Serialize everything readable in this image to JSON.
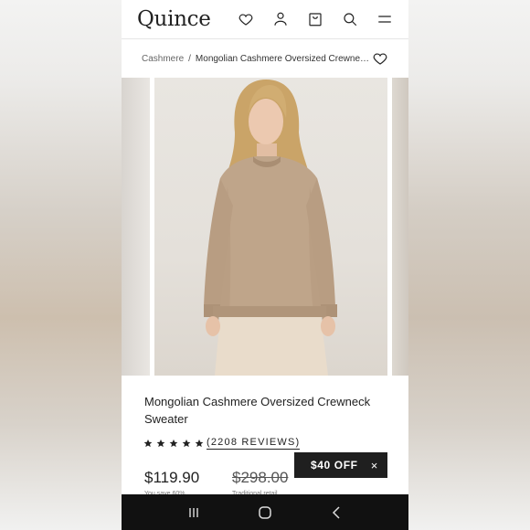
{
  "header": {
    "logo": "Quince",
    "icons": [
      "heart-icon",
      "user-icon",
      "bag-icon",
      "search-icon",
      "menu-icon"
    ]
  },
  "breadcrumb": {
    "home": "Cashmere",
    "separator": "/",
    "current": "Mongolian Cashmere Oversized Crewneck S..."
  },
  "product": {
    "title": "Mongolian Cashmere Oversized Crewneck Sweater",
    "rating_stars": 5,
    "reviews": "(2208 REVIEWS)",
    "price": "$119.90",
    "price_note": "You save 60%",
    "old_price": "$298.00",
    "old_price_note": "Traditional retail"
  },
  "promo": {
    "label": "$40 OFF",
    "close": "×"
  },
  "colors": {
    "text": "#222222",
    "promo_bg": "#1f1f1f",
    "navbar_bg": "#111111"
  },
  "navbar": {
    "icons": [
      "recent-apps-icon",
      "home-icon",
      "back-icon"
    ]
  }
}
